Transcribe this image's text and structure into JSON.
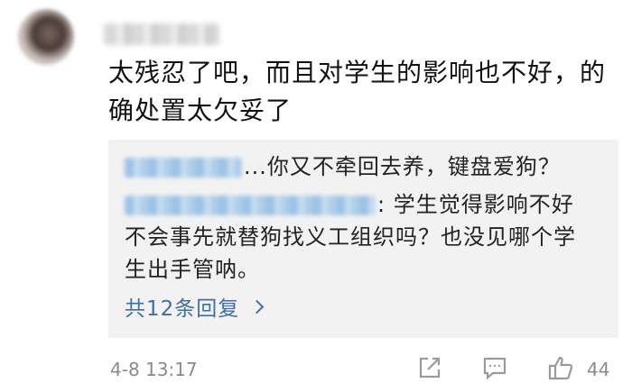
{
  "comment": {
    "text": "太残忍了吧，而且对学生的影响也不好，的确处置太欠妥了"
  },
  "replies": [
    {
      "text": "...你又不牵回去养，键盘爱狗？"
    },
    {
      "text": ": 学生觉得影响不好 不会事先就替狗找义工组织吗？也没见哪个学生出手管呐。"
    }
  ],
  "more_replies_label": "共12条回复",
  "footer": {
    "timestamp": "4-8 13:17",
    "like_count": "44"
  },
  "icons": [
    "share-icon",
    "comment-icon",
    "like-icon",
    "chevron-right-icon"
  ],
  "colors": {
    "link": "#3f6ea8",
    "meta": "#8a8a8a",
    "reply_bg": "#f2f2f2"
  }
}
